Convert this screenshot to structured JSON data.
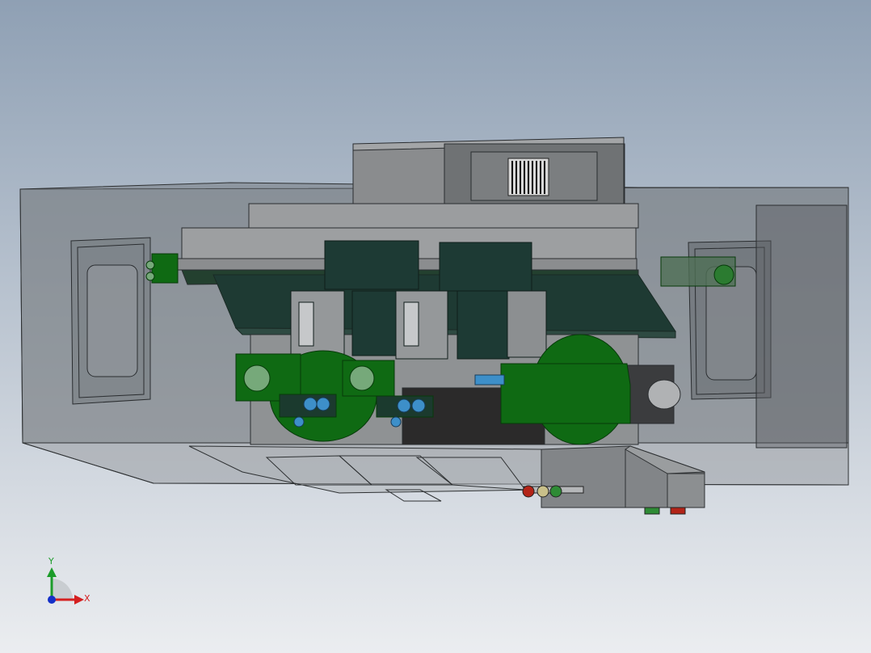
{
  "viewport": {
    "background_top": "#8fa0b4",
    "background_bottom": "#ebedf0"
  },
  "model": {
    "enclosure_color": "#7f8386",
    "housing_color": "#9a9c9e",
    "dark_panel_color": "#1e3a33",
    "green_part_color": "#0f6a13",
    "blue_part_color": "#3d8fc9",
    "red_part_color": "#b32418",
    "yellow_part_color": "#c9c08a",
    "icons": [
      "vent-grille-icon",
      "motor-icon",
      "pneumatic-fitting-icon"
    ]
  },
  "triad": {
    "x_label": "X",
    "y_label": "Y",
    "x_color": "#d42020",
    "y_color": "#1c9c2a",
    "z_color": "#1430c8"
  }
}
